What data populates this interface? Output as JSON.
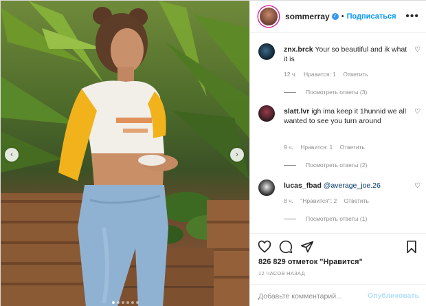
{
  "post": {
    "username": "sommerray",
    "separator": "•",
    "follow_label": "Подписаться",
    "more_label": "•••",
    "verified_glyph": "✓",
    "likes_text": "826 829 отметок \"Нравится\"",
    "time_text": "12 ЧАСОВ НАЗАД",
    "add_comment_placeholder": "Добавьте комментарий...",
    "publish_label": "Опубликовать",
    "nav_prev_glyph": "‹",
    "nav_next_glyph": "›",
    "carousel_active_index": 0,
    "carousel_count": 6
  },
  "comments": [
    {
      "username": "znx.brck",
      "text": "Your so beautiful and ik what it is",
      "mention": "",
      "time": "12 ч.",
      "likes": "Нравится: 1",
      "reply_label": "Ответить",
      "replies_label": "Посмотреть ответы (3)"
    },
    {
      "username": "slatt.lvr",
      "text": "igh ima keep it 1hunnid we all wanted to see you turn around",
      "mention": "",
      "time": "9 ч.",
      "likes": "Нравится: 1",
      "reply_label": "Ответить",
      "replies_label": "Посмотреть ответы (2)"
    },
    {
      "username": "lucas_fbad",
      "text": "",
      "mention": "@average_joe.26",
      "time": "8 ч.",
      "likes": "\"Нравится\": 2",
      "reply_label": "Ответить",
      "replies_label": "Посмотреть ответы (1)"
    }
  ],
  "icons": {
    "heart": "heart-icon",
    "comment": "comment-icon",
    "share": "share-icon",
    "bookmark": "bookmark-icon",
    "heart_small": "♡"
  },
  "colors": {
    "link_blue": "#0095f6",
    "verified_blue": "#3897f0",
    "meta_gray": "#8e8e8e",
    "text": "#262626",
    "publish_disabled": "#b2dffc"
  }
}
